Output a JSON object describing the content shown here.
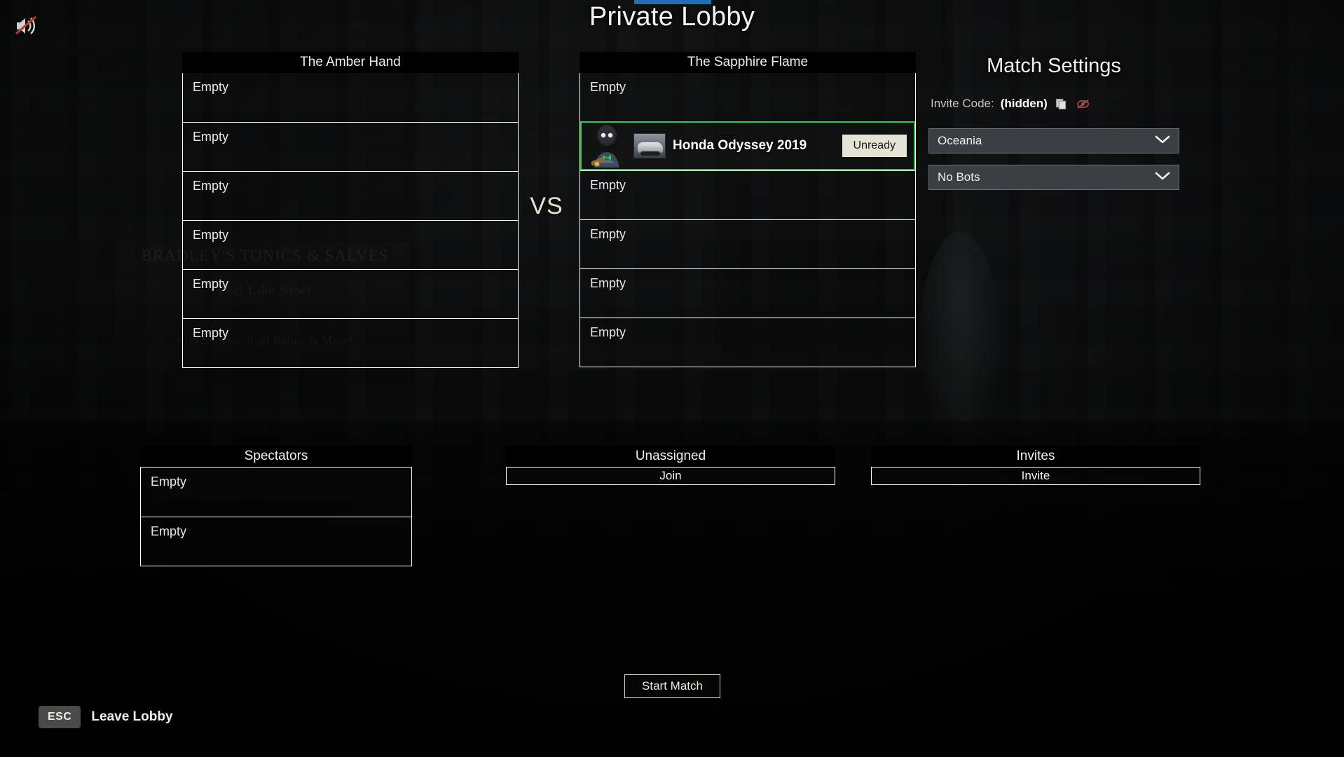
{
  "window": {
    "title": "Private Lobby"
  },
  "top_bar": {
    "accent_color": "#1f6fb2",
    "mute_icon": "speaker-muted-icon"
  },
  "teams": [
    {
      "id": "team-left",
      "name": "The Amber Hand",
      "slots": [
        {
          "type": "empty",
          "label": "Empty"
        },
        {
          "type": "empty",
          "label": "Empty"
        },
        {
          "type": "empty",
          "label": "Empty"
        },
        {
          "type": "empty",
          "label": "Empty"
        },
        {
          "type": "empty",
          "label": "Empty"
        },
        {
          "type": "empty",
          "label": "Empty"
        }
      ]
    },
    {
      "id": "team-right",
      "name": "The Sapphire Flame",
      "slots": [
        {
          "type": "empty",
          "label": "Empty"
        },
        {
          "type": "player",
          "player_name": "Honda Odyssey 2019",
          "ready_label": "Unready",
          "ready_state": "unready",
          "highlight_color": "#3fbf54",
          "avatar_icon": "player-avatar-icon",
          "vehicle_icon": "car-thumbnail-icon"
        },
        {
          "type": "empty",
          "label": "Empty"
        },
        {
          "type": "empty",
          "label": "Empty"
        },
        {
          "type": "empty",
          "label": "Empty"
        },
        {
          "type": "empty",
          "label": "Empty"
        }
      ]
    }
  ],
  "vs_label": "VS",
  "match_settings": {
    "title": "Match Settings",
    "invite_code_label": "Invite Code:",
    "invite_code_value": "(hidden)",
    "copy_icon": "copy-icon",
    "reveal_icon": "eye-off-icon",
    "reveal_icon_color": "#b04a4a",
    "region_dropdown": {
      "selected": "Oceania",
      "chevron_icon": "chevron-down-icon"
    },
    "bots_dropdown": {
      "selected": "No Bots",
      "chevron_icon": "chevron-down-icon"
    }
  },
  "spectators": {
    "title": "Spectators",
    "slots": [
      {
        "label": "Empty"
      },
      {
        "label": "Empty"
      }
    ]
  },
  "unassigned": {
    "title": "Unassigned",
    "join_label": "Join"
  },
  "invites": {
    "title": "Invites",
    "invite_label": "Invite"
  },
  "start_match": {
    "label": "Start Match"
  },
  "leave_lobby": {
    "key": "ESC",
    "label": "Leave Lobby"
  },
  "background": {
    "sign_line_1": "BRADLEY'S TONICS & SALVES",
    "sign_line_2": "Feel Like New!",
    "sign_line_3": "with Serums, Sual Balms & More!"
  }
}
